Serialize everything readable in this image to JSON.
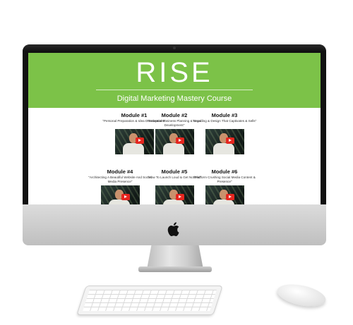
{
  "brand": {
    "logo_text": "RISE",
    "subtitle": "Digital Marketing Mastery Course",
    "accent_color": "#7cc248"
  },
  "modules": [
    {
      "title": "Module #1",
      "description": "\"Personal Preparation & Idea Development\""
    },
    {
      "title": "Module #2",
      "description": "\"Essential Business Planning & Legal Development\""
    },
    {
      "title": "Module #3",
      "description": "\"Branding & Design That Captivates & Sells\""
    },
    {
      "title": "Module #4",
      "description": "\"Architecting A Beautiful Website And Social Media Presence\""
    },
    {
      "title": "Module #5",
      "description": "\"How To Launch Loud & Get Noticed\""
    },
    {
      "title": "Module #6",
      "description": "\"Platform Crushing Social Media Content & Presence\""
    }
  ],
  "icons": {
    "play": "play-button-icon",
    "apple": "apple-logo-icon"
  }
}
